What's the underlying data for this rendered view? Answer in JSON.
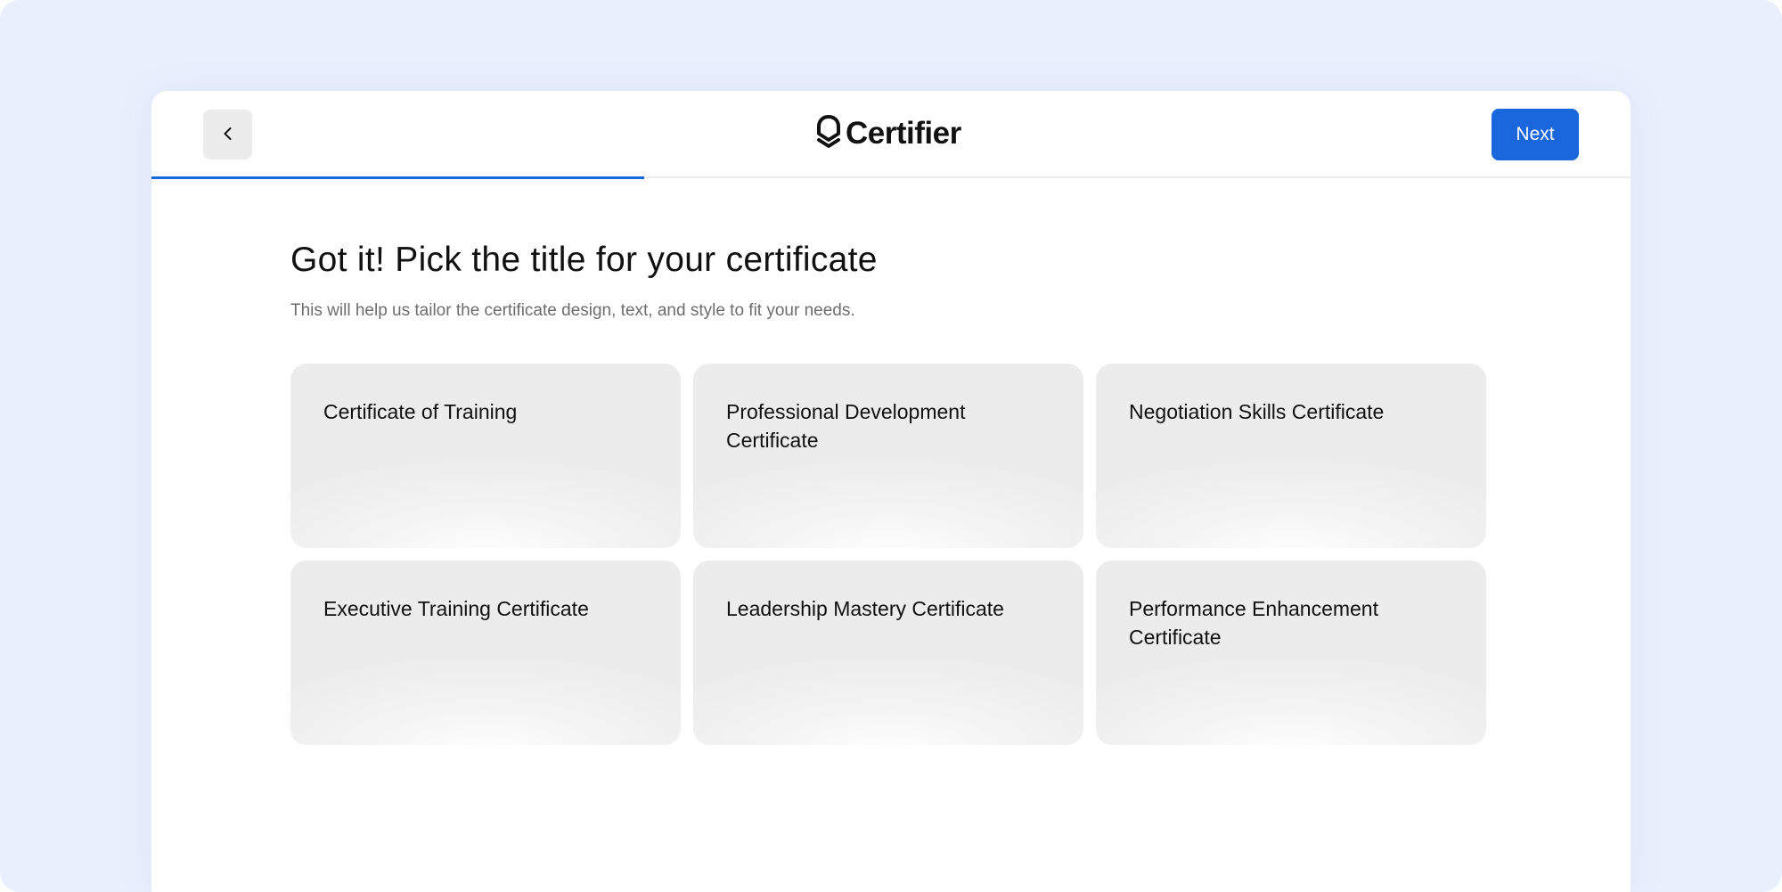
{
  "app": {
    "logo_text": "Certifier"
  },
  "header": {
    "back_label": "",
    "next_label": "Next",
    "progress_fraction": 0.333
  },
  "main": {
    "heading": "Got it! Pick the title for your certificate",
    "subtitle": "This will help us tailor the certificate design, text, and style to fit your needs.",
    "options": [
      {
        "label": "Certificate of Training"
      },
      {
        "label": "Professional Development Certificate"
      },
      {
        "label": "Negotiation Skills Certificate"
      },
      {
        "label": "Executive Training Certificate"
      },
      {
        "label": "Leadership Mastery Certificate"
      },
      {
        "label": "Performance Enhancement Certificate"
      }
    ]
  },
  "colors": {
    "accent": "#1a66dc",
    "backdrop": "#e8effd",
    "card": "#ececec",
    "text": "#111111",
    "muted_text": "#6d6d6d"
  },
  "icons": {
    "back": "chevron-left-icon",
    "logo": "certifier-logo-icon"
  }
}
